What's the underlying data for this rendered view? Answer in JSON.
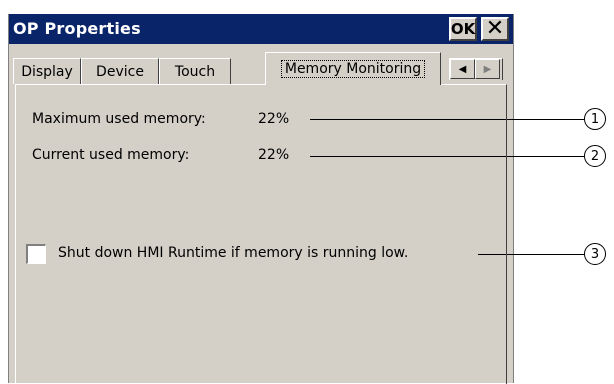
{
  "window": {
    "title": "OP Properties",
    "ok_label": "OK",
    "close_label": "✕"
  },
  "tabs": [
    {
      "label": "Display"
    },
    {
      "label": "Device"
    },
    {
      "label": "Touch"
    },
    {
      "label": "Memory Monitoring",
      "active": true
    }
  ],
  "scroll": {
    "left": "◀",
    "right": "▶"
  },
  "memory": {
    "max_label": "Maximum used memory:",
    "max_value": "22%",
    "current_label": "Current used memory:",
    "current_value": "22%",
    "shutdown_label": "Shut down HMI Runtime if memory is running low.",
    "shutdown_checked": false
  },
  "callouts": [
    "1",
    "2",
    "3"
  ],
  "colors": {
    "titlebar": "#0a246a",
    "face": "#d4d0c8"
  }
}
